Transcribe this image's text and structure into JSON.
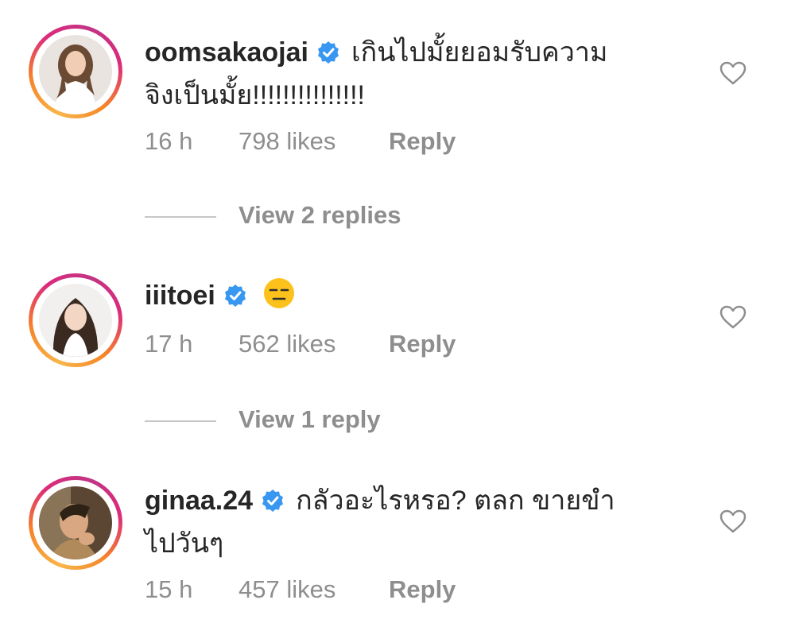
{
  "comments": [
    {
      "username": "oomsakaojai",
      "text_line1": "เกินไปมั้ยยอมรับความ",
      "text_line2": "จิงเป็นมั้ย!!!!!!!!!!!!!!!",
      "time": "16 h",
      "likes": "798 likes",
      "reply_label": "Reply",
      "view_replies": "View 2 replies",
      "avatar_icon": "woman-white-shirt-avatar"
    },
    {
      "username": "iiitoei",
      "emoji": "😑",
      "time": "17 h",
      "likes": "562 likes",
      "reply_label": "Reply",
      "view_replies": "View 1 reply",
      "avatar_icon": "woman-long-hair-avatar"
    },
    {
      "username": "ginaa.24",
      "text_line1": "กลัวอะไรหรอ? ตลก ขายขำ",
      "text_line2": "ไปวันๆ",
      "time": "15 h",
      "likes": "457 likes",
      "reply_label": "Reply",
      "avatar_icon": "woman-portrait-avatar"
    }
  ],
  "icons": {
    "verified": "verified-badge-icon",
    "like": "heart-outline-icon"
  },
  "colors": {
    "verified_blue": "#3897f0",
    "muted_gray": "#8e8e8e",
    "text": "#262626"
  }
}
